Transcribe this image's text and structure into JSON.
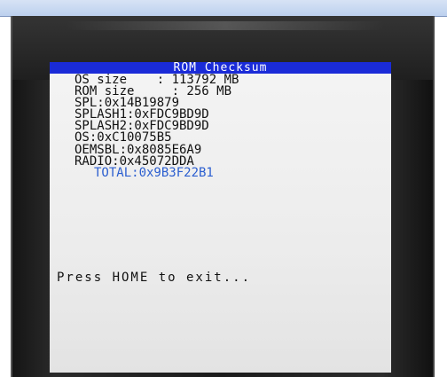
{
  "screen": {
    "title": "ROM Checksum",
    "lines": [
      "OS size    : 113792 MB",
      "ROM size     : 256 MB",
      "SPL:0x14B19879",
      "SPLASH1:0xFDC9BD9D",
      "SPLASH2:0xFDC9BD9D",
      "OS:0xC10075B5",
      "OEMSBL:0x8085E6A9",
      "RADIO:0x45072DDA"
    ],
    "total": "TOTAL:0x9B3F22B1",
    "exit_prompt": "Press HOME to exit..."
  },
  "colors": {
    "title_bar": "#1a2bd8",
    "total_text": "#2c5fd0",
    "screen_bg": "#f0f0f0"
  }
}
